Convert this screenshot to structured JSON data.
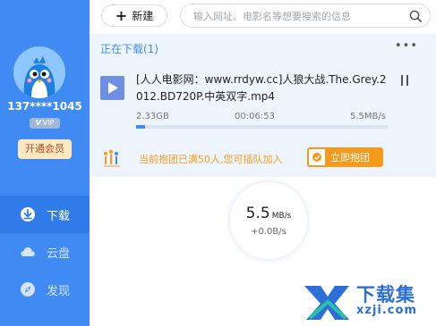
{
  "sidebar": {
    "username": "137****1045",
    "vip_label": "VIP",
    "member_button": "开通会员",
    "nav": [
      {
        "label": "下载",
        "icon": "download-icon",
        "active": true
      },
      {
        "label": "云盘",
        "icon": "cloud-icon",
        "active": false
      },
      {
        "label": "发现",
        "icon": "compass-icon",
        "active": false
      }
    ]
  },
  "toolbar": {
    "new_label": "新建",
    "search_placeholder": "输入网址、电影名等想要搜索的信息"
  },
  "downloads": {
    "section_title": "正在下载(1)",
    "task": {
      "name": "[人人电影网：www.rrdyw.cc]人狼大战.The.Grey.2012.BD720P.中英双字.mp4",
      "size": "2.33GB",
      "time_remaining": "00:06:53",
      "speed": "5.5MB/s",
      "progress_fraction": 0.035
    },
    "group_promo": {
      "text": "当前抱团已满50人,您可插队加入",
      "button": "立即抱团"
    },
    "speed_display": {
      "value": "5.5",
      "unit": "MB/s",
      "extra": "+0.0B/s"
    }
  },
  "watermark": {
    "title": "下载集",
    "domain": "xzji.com"
  },
  "colors": {
    "sidebar": "#3f8bf3",
    "accent": "#3f8bf3",
    "orange": "#f59a1a",
    "task_bg": "#eef4fc"
  }
}
